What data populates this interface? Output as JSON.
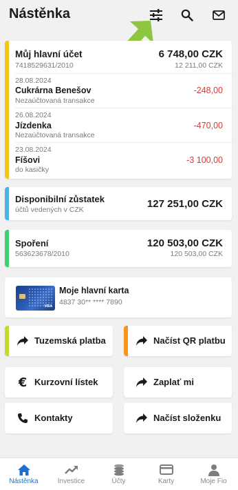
{
  "header": {
    "title": "Nástěnka",
    "icons": [
      "sliders-icon",
      "search-icon",
      "mail-icon"
    ]
  },
  "main_account": {
    "name": "Můj hlavní účet",
    "number": "7418529631/2010",
    "balance": "6 748,00 CZK",
    "available": "12 211,00 CZK",
    "stripe_color": "#f5c518",
    "transactions": [
      {
        "date": "28.08.2024",
        "name": "Cukrárna Benešov",
        "note": "Nezaúčtovaná transakce",
        "amount": "-248,00"
      },
      {
        "date": "26.08.2024",
        "name": "Jízdenka",
        "note": "Nezaúčtovaná transakce",
        "amount": "-470,00"
      },
      {
        "date": "23.08.2024",
        "name": "Fíšovi",
        "note": "do kasičky",
        "amount": "-3 100,00"
      }
    ]
  },
  "available_balance": {
    "title": "Disponibilní zůstatek",
    "subtitle": "účtů vedených v CZK",
    "amount": "127 251,00 CZK",
    "stripe_color": "#4fb3e8"
  },
  "savings": {
    "name": "Spoření",
    "number": "563623678/2010",
    "balance": "120 503,00 CZK",
    "available": "120 503,00 CZK",
    "stripe_color": "#3fcf6e"
  },
  "card": {
    "name": "Moje hlavní karta",
    "number": "4837 30** **** 7890",
    "visa_text": "VISA"
  },
  "quick_actions": [
    {
      "label": "Tuzemská platba",
      "icon": "share-arrow-icon",
      "stripe_color": "#c6d92d"
    },
    {
      "label": "Načíst QR platbu",
      "icon": "share-arrow-icon",
      "stripe_color": "#f7941d"
    },
    {
      "label": "Kurzovní lístek",
      "icon": "euro-icon",
      "stripe_color": ""
    },
    {
      "label": "Zaplať mi",
      "icon": "share-arrow-icon",
      "stripe_color": ""
    },
    {
      "label": "Kontakty",
      "icon": "phone-icon",
      "stripe_color": ""
    },
    {
      "label": "Načíst složenku",
      "icon": "share-arrow-icon",
      "stripe_color": ""
    }
  ],
  "bottom_nav": [
    {
      "label": "Nástěnka",
      "icon": "home-icon",
      "active": true
    },
    {
      "label": "Investice",
      "icon": "trending-up-icon",
      "active": false
    },
    {
      "label": "Účty",
      "icon": "coins-icon",
      "active": false
    },
    {
      "label": "Karty",
      "icon": "credit-card-icon",
      "active": false
    },
    {
      "label": "Moje Fio",
      "icon": "person-icon",
      "active": false
    }
  ],
  "colors": {
    "accent": "#1f6fd1",
    "negative": "#d8383a",
    "hint_arrow": "#8dc63f"
  }
}
